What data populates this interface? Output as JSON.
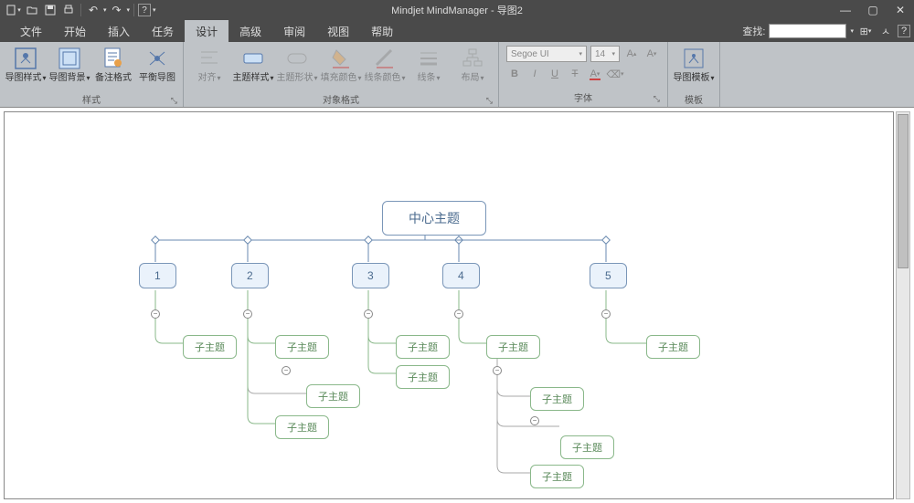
{
  "title": "Mindjet MindManager - 导图2",
  "qat": {
    "new": "",
    "open": "",
    "save": "",
    "print": "",
    "undo": "↶",
    "redo": "↷",
    "help": "?"
  },
  "menu": {
    "file": "文件",
    "home": "开始",
    "insert": "插入",
    "task": "任务",
    "design": "设计",
    "advanced": "高级",
    "review": "审阅",
    "view": "视图",
    "help": "帮助"
  },
  "search": {
    "label": "查找:",
    "placeholder": ""
  },
  "ribbon": {
    "style_group": "样式",
    "map_style": "导图样式",
    "map_bg": "导图背景",
    "note_fmt": "备注格式",
    "balance": "平衡导图",
    "obj_group": "对象格式",
    "align": "对齐",
    "topic_style": "主题样式",
    "topic_shape": "主题形状",
    "fill": "填充颜色",
    "line_color": "线条颜色",
    "line": "线条",
    "layout": "布局",
    "font_group": "字体",
    "font_name": "Segoe UI",
    "font_size": "14",
    "tpl_group": "模板",
    "map_tpl": "导图模板"
  },
  "mindmap": {
    "center": "中心主题",
    "main": [
      "1",
      "2",
      "3",
      "4",
      "5"
    ],
    "sub": "子主题"
  },
  "toggle_minus": "−"
}
